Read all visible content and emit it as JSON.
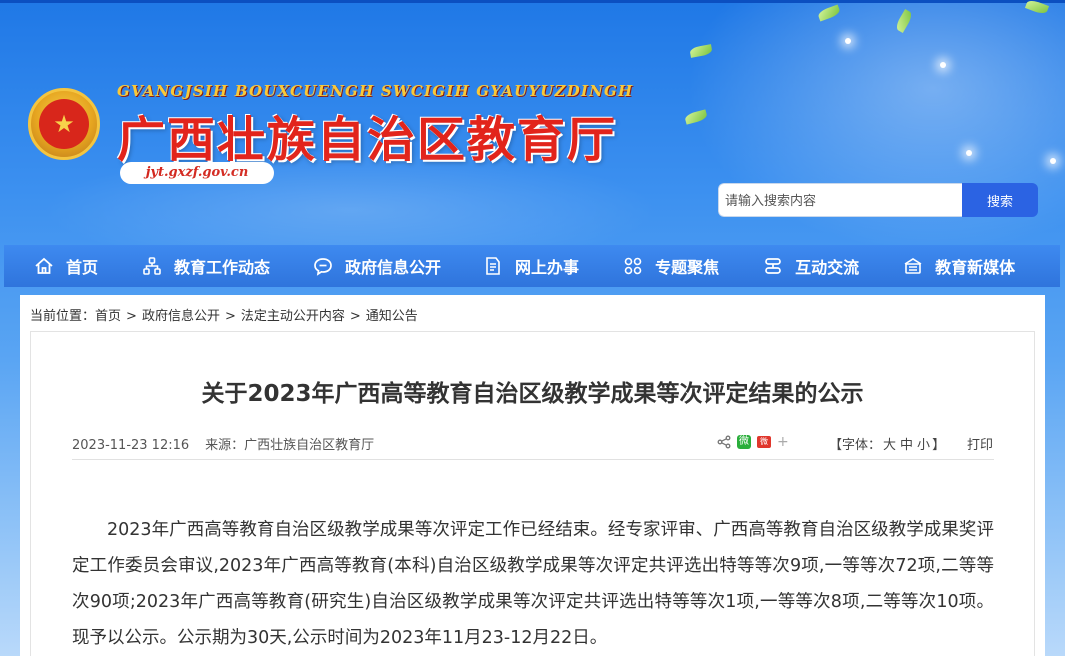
{
  "site": {
    "roman_name": "GVANGJSIH BOUXCUENGH SWCIGIH GYAUYUZDINGH",
    "title": "广西壮族自治区教育厅",
    "domain": "jyt.gxzf.gov.cn"
  },
  "search": {
    "placeholder": "请输入搜索内容",
    "button_label": "搜索"
  },
  "nav": {
    "items": [
      {
        "label": "首页",
        "icon": "home-icon"
      },
      {
        "label": "教育工作动态",
        "icon": "org-chart-icon"
      },
      {
        "label": "政府信息公开",
        "icon": "chat-bubble-icon"
      },
      {
        "label": "网上办事",
        "icon": "document-edit-icon"
      },
      {
        "label": "专题聚焦",
        "icon": "grid-icon"
      },
      {
        "label": "互动交流",
        "icon": "exchange-icon"
      },
      {
        "label": "教育新媒体",
        "icon": "media-icon"
      }
    ]
  },
  "breadcrumb": {
    "prefix": "当前位置：",
    "items": [
      "首页",
      "政府信息公开",
      "法定主动公开内容",
      "通知公告"
    ],
    "separator": ">"
  },
  "article": {
    "title": "关于2023年广西高等教育自治区级教学成果等次评定结果的公示",
    "date": "2023-11-23 12:16",
    "source": "来源：广西壮族自治区教育厅",
    "font_size_prefix": "【字体：",
    "font_size_large": "大",
    "font_size_medium": "中",
    "font_size_small": "小",
    "font_size_suffix": "】",
    "print_label": "打印",
    "share_wechat_text": "微",
    "share_weibo_text": "微",
    "paragraph": "2023年广西高等教育自治区级教学成果等次评定工作已经结束。经专家评审、广西高等教育自治区级教学成果奖评定工作委员会审议,2023年广西高等教育(本科)自治区级教学成果等次评定共评选出特等等次9项,一等等次72项,二等等次90项;2023年广西高等教育(研究生)自治区级教学成果等次评定共评选出特等等次1项,一等等次8项,二等等次10项。现予以公示。公示期为30天,公示时间为2023年11月23-12月22日。"
  },
  "colors": {
    "nav_bg": "#2f74dc",
    "title_red": "#e2241b",
    "search_button": "#2b63e3"
  }
}
